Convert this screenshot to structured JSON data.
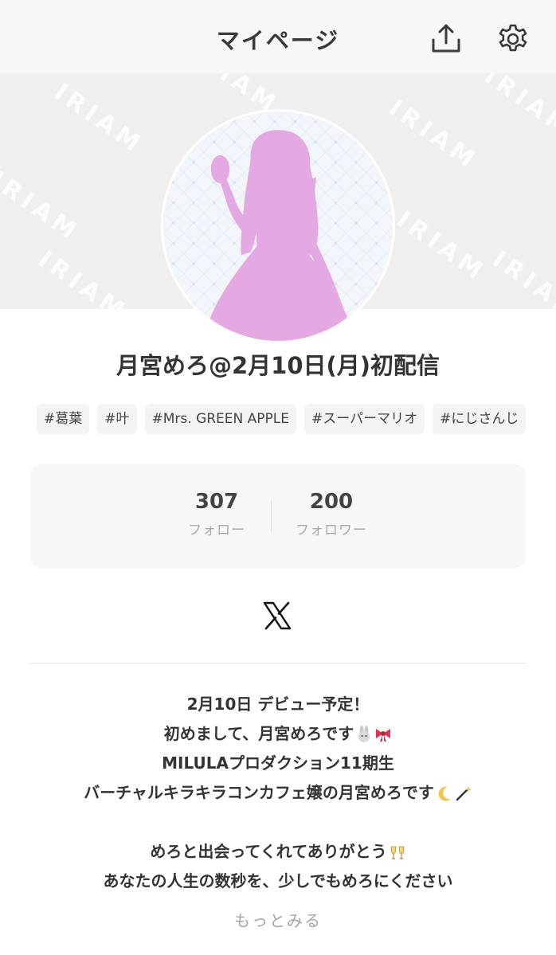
{
  "header": {
    "title": "マイページ"
  },
  "banner": {
    "watermark": "IRIAM"
  },
  "profile": {
    "name": "月宮めろ@2月10日(月)初配信"
  },
  "tags": [
    "#葛葉",
    "#叶",
    "#Mrs. GREEN APPLE",
    "#スーパーマリオ",
    "#にじさんじ"
  ],
  "stats": {
    "follow_count": "307",
    "follow_label": "フォロー",
    "follower_count": "200",
    "follower_label": "フォロワー"
  },
  "social": {
    "x_icon": "x-logo-icon"
  },
  "bio": {
    "line1": "2月10日 デビュー予定！",
    "line2": "初めまして、月宮めろです",
    "line3": "MILULAプロダクション11期生",
    "line4": "バーチャルキラキラコンカフェ嬢の月宮めろです",
    "line5": "めろと出会ってくれてありがとう",
    "line6": "あなたの人生の数秒を、少しでもめろにください"
  },
  "more_label": "もっとみる",
  "colors": {
    "silhouette": "#e4a8e3",
    "banner_bg": "#efefef",
    "stats_bg": "#f7f7f8"
  }
}
